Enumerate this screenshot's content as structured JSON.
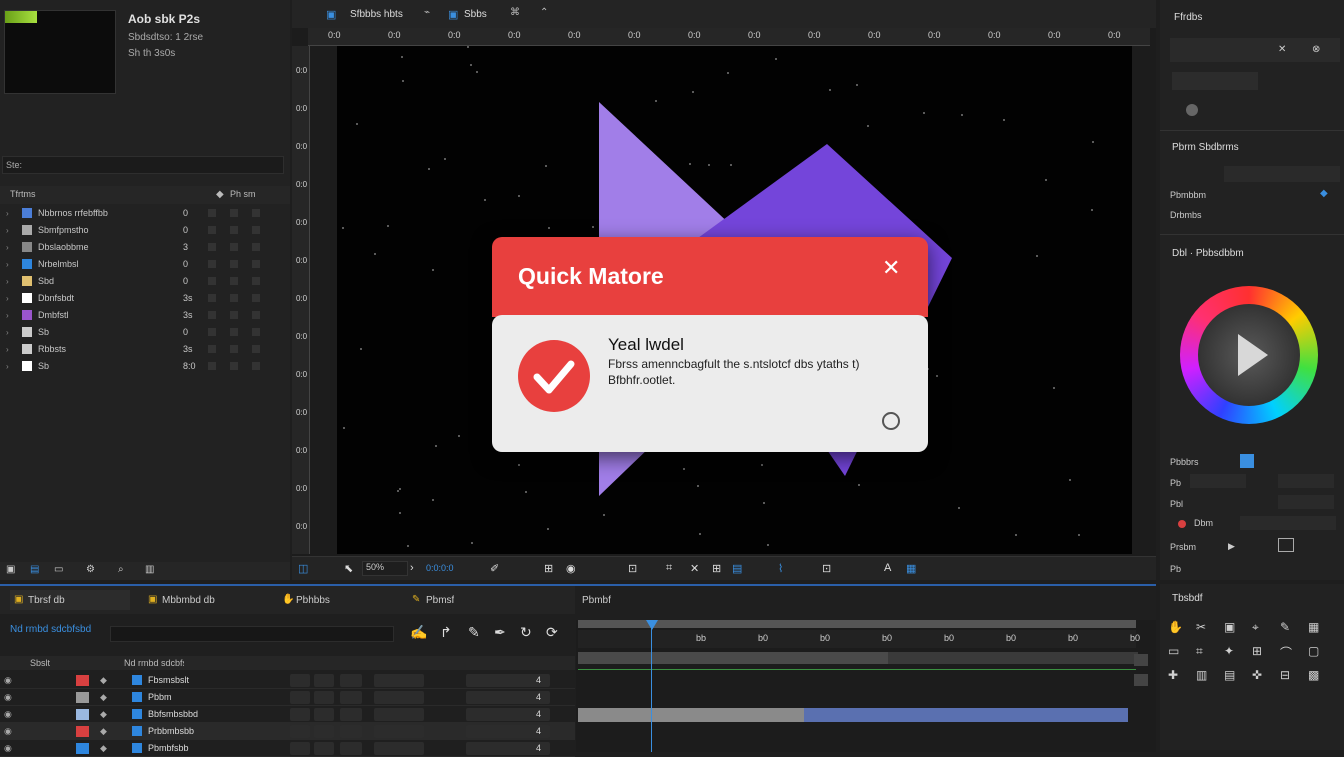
{
  "project": {
    "title": "Aob sbk P2s",
    "meta1": "Sbdsdtso: 1 2rse",
    "meta2": "Sh th 3s0s",
    "search_placeholder": "Ste:",
    "header_name": "Tfrtms",
    "header_tools": "Ph sm"
  },
  "project_items": [
    {
      "name": "Nbbrnos rrfebffbb",
      "num": "0",
      "color": "#4b7ed8"
    },
    {
      "name": "Sbmfpmstho",
      "num": "0",
      "color": "#aaaaaa"
    },
    {
      "name": "Dbslaobbme",
      "num": "3",
      "color": "#888888"
    },
    {
      "name": "Nrbelmbsl",
      "num": "0",
      "color": "#2e86de"
    },
    {
      "name": "Sbd",
      "num": "0",
      "color": "#e0c070"
    },
    {
      "name": "Dbnfsbdt",
      "num": "3s",
      "color": "#ffffff"
    },
    {
      "name": "Dmbfstl",
      "num": "3s",
      "color": "#9a55cc"
    },
    {
      "name": "Sb",
      "num": "0",
      "color": "#cccccc"
    },
    {
      "name": "Rbbsts",
      "num": "3s",
      "color": "#cccccc"
    },
    {
      "name": "Sb",
      "num": "8:0",
      "color": "#ffffff"
    }
  ],
  "viewer": {
    "tab1": "Sfbbbs hbts",
    "tab2": "Sbbs",
    "ruler_ticks": [
      "0:0",
      "0:0",
      "0:0",
      "0:0",
      "0:0",
      "0:0",
      "0:0",
      "0:0",
      "0:0",
      "0:0",
      "0:0",
      "0:0",
      "0:0",
      "0:0"
    ],
    "zoom_label": "50%",
    "timecode": "0:0:0:0"
  },
  "dialog": {
    "title": "Quick Matore",
    "heading": "Yeal lwdel",
    "body_line1": "Fbrss amenncbagfult the s.ntslotcf dbs ytaths t)",
    "body_line2": "Bfbhfr.ootlet.",
    "accent": "#e8403e"
  },
  "effects_panel": {
    "title": "Ffrdbs",
    "section2": "Pbrm Sbdbrms",
    "field1": "Pbmbbm",
    "field2": "Drbmbs",
    "section3": "Dbl · Pbbsdbbm",
    "row_a": "Pbbbrs",
    "row_b": "Pb",
    "row_c": "Pbl",
    "row_d": "Dbm",
    "row_e": "Prsbm",
    "row_f": "Pb"
  },
  "timeline": {
    "tabs": [
      "Tbrsf db",
      "Mbbmbd db",
      "Pbhbbs",
      "Pbmsf"
    ],
    "panel_title": "Pbmbf",
    "comp_label": "Nd rmbd sdcbfsbd",
    "layer_header": "Sbslt",
    "layers": [
      {
        "name": "Fbsmsbslt",
        "color": "#d84040",
        "val": "4"
      },
      {
        "name": "Pbbm",
        "color": "#999999",
        "val": "4"
      },
      {
        "name": "Bbfsmbsbbd",
        "color": "#9ab8e0",
        "val": "4"
      },
      {
        "name": "Prbbmbsbb",
        "color": "#d84040",
        "val": "4"
      },
      {
        "name": "Pbmbfsbb",
        "color": "#2e86de",
        "val": "4"
      }
    ],
    "ticks": [
      "bb",
      "b0",
      "b0",
      "b0",
      "b0",
      "b0",
      "b0",
      "b0",
      "b0"
    ]
  },
  "tools_panel": {
    "title": "Tbsbdf"
  },
  "colors": {
    "bg": "#1e1e1e",
    "panel": "#232323",
    "accent_blue": "#3a8fe0",
    "purple_light": "#a07ee6",
    "purple_dark": "#7040d8"
  }
}
